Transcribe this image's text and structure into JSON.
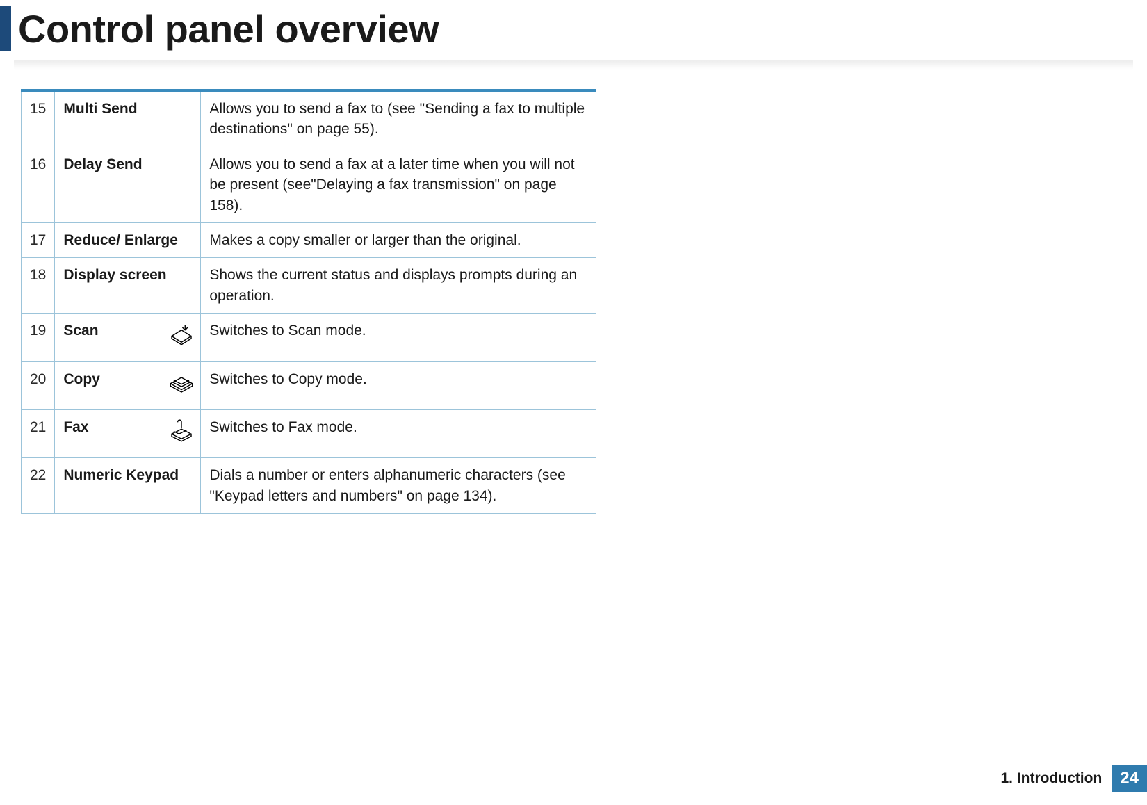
{
  "title": "Control panel overview",
  "rows": [
    {
      "num": "15",
      "name": "Multi Send",
      "icon": null,
      "desc": "Allows you to send a fax to (see \"Sending a fax to multiple destinations\" on page 55)."
    },
    {
      "num": "16",
      "name": "Delay Send",
      "icon": null,
      "desc": "Allows you to send a fax at a later time when you will not be present (see\"Delaying a fax transmission\" on page 158)."
    },
    {
      "num": "17",
      "name": "Reduce/ Enlarge",
      "icon": null,
      "desc": "Makes a copy smaller or larger than the original."
    },
    {
      "num": "18",
      "name": "Display screen",
      "icon": null,
      "desc": "Shows the current status and displays prompts during an operation."
    },
    {
      "num": "19",
      "name": "Scan",
      "icon": "scan-icon",
      "desc": "Switches to Scan mode."
    },
    {
      "num": "20",
      "name": "Copy",
      "icon": "copy-icon",
      "desc": "Switches to Copy mode."
    },
    {
      "num": "21",
      "name": "Fax",
      "icon": "fax-icon",
      "desc": "Switches to Fax mode."
    },
    {
      "num": "22",
      "name": "Numeric Keypad",
      "icon": null,
      "desc": "Dials a number or enters alphanumeric characters (see \"Keypad letters and numbers\" on page 134)."
    }
  ],
  "footer": {
    "chapter": "1.  Introduction",
    "page": "24"
  }
}
